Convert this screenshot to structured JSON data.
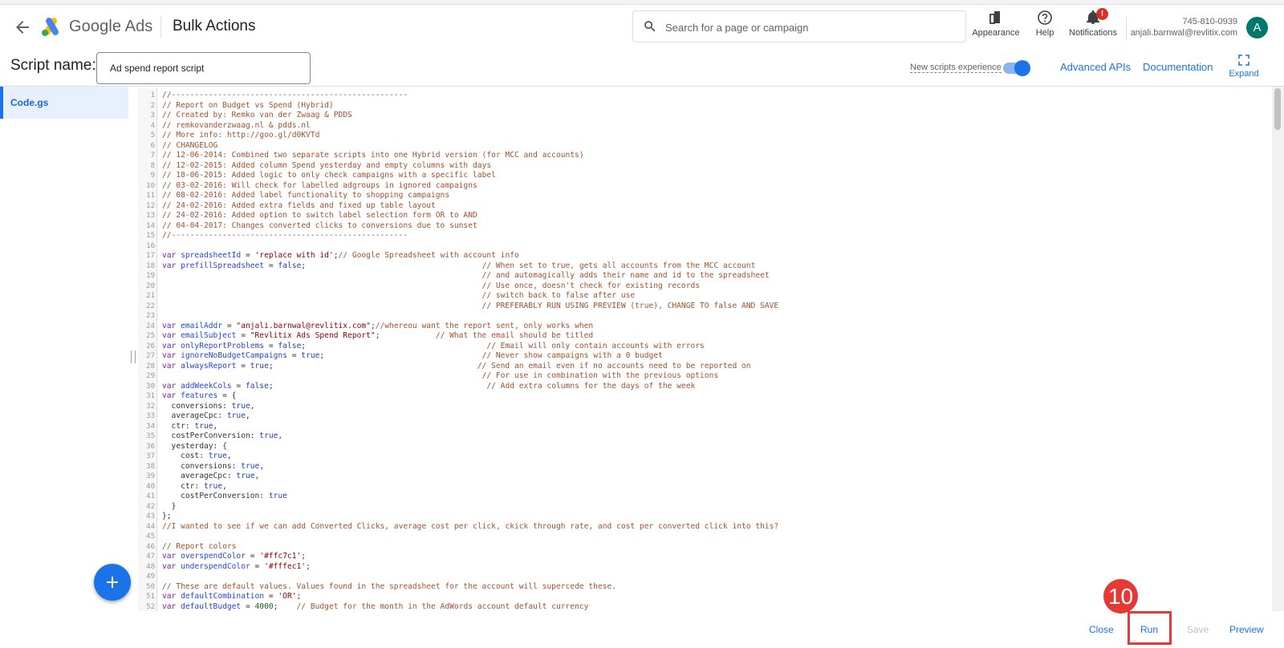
{
  "header": {
    "brand": "Google Ads",
    "page_title": "Bulk Actions",
    "search_placeholder": "Search for a page or campaign",
    "appearance_label": "Appearance",
    "help_label": "Help",
    "notifications_label": "Notifications",
    "notifications_count": "!",
    "account_id": "745-810-0939",
    "account_email": "anjali.barnwal@revlitix.com",
    "avatar_letter": "A"
  },
  "toolbar": {
    "script_name_label": "Script name:",
    "script_name_value": "Ad spend report script",
    "new_scripts_label": "New scripts experience",
    "new_scripts_enabled": true,
    "advanced_apis": "Advanced APIs",
    "documentation": "Documentation",
    "expand": "Expand"
  },
  "sidebar": {
    "files": [
      "Code.gs"
    ]
  },
  "editor": {
    "lines": [
      "//---------------------------------------------------",
      "// Report on Budget vs Spend (Hybrid)",
      "// Created by: Remko van der Zwaag & PDDS",
      "// remkovanderzwaag.nl & pdds.nl",
      "// More info: http://goo.gl/d0KVTd",
      "// CHANGELOG",
      "// 12-06-2014: Combined two separate scripts into one Hybrid version (for MCC and accounts)",
      "// 12-02-2015: Added column Spend yesterday and empty columns with days",
      "// 18-06-2015: Added logic to only check campaigns with a specific label",
      "// 03-02-2016: Will check for labelled adgroups in ignored campaigns",
      "// 08-02-2016: Added label functionality to shopping campaigns",
      "// 24-02-2016: Added extra fields and fixed up table layout",
      "// 24-02-2016: Added option to switch label selection form OR to AND",
      "// 04-04-2017: Changes converted clicks to conversions due to sunset",
      "//---------------------------------------------------",
      "",
      "var spreadsheetId = 'replace with id';// Google Spreadsheet with account info",
      "var prefillSpreadsheet = false;                                      // When set to true, gets all accounts from the MCC account",
      "                                                                     // and automagically adds their name and id to the spreadsheet",
      "                                                                     // Use once, doesn't check for existing records",
      "                                                                     // switch back to false after use",
      "                                                                     // PREFERABLY RUN USING PREVIEW (true), CHANGE TO false AND SAVE",
      "",
      "var emailAddr = \"anjali.barnwal@revlitix.com\";//whereou want the report sent, only works when",
      "var emailSubject = \"Revlitix Ads Spend Report\";            // What the email should be titled",
      "var onlyReportProblems = false;                                       // Email will only contain accounts with errors",
      "var ignoreNoBudgetCampaigns = true;                                  // Never show campaigns with a 0 budget",
      "var alwaysReport = true;                                            // Send an email even if no accounts need to be reported on",
      "                                                                     // For use in combination with the previous options",
      "var addWeekCols = false;                                              // Add extra columns for the days of the week",
      "var features = {",
      "  conversions: true,",
      "  averageCpc: true,",
      "  ctr: true,",
      "  costPerConversion: true,",
      "  yesterday: {",
      "    cost: true,",
      "    conversions: true,",
      "    averageCpc: true,",
      "    ctr: true,",
      "    costPerConversion: true",
      "  }",
      "};",
      "//I wanted to see if we can add Converted Clicks, average cost per click, ckick through rate, and cost per converted click into this?",
      "",
      "// Report colors",
      "var overspendColor = '#ffc7c1';",
      "var underspendColor = '#fffec1';",
      "",
      "// These are default values. Values found in the spreadsheet for the account will supercede these.",
      "var defaultCombination = 'OR';",
      "var defaultBudget = 4000;    // Budget for the month in the AdWords account default currency"
    ]
  },
  "footer": {
    "close": "Close",
    "run": "Run",
    "save": "Save",
    "preview": "Preview"
  },
  "annotation": {
    "step": "10"
  }
}
